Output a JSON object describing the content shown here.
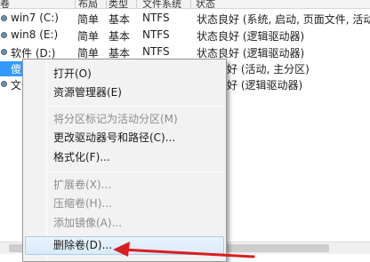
{
  "table": {
    "headers": [
      "卷",
      "布局",
      "类型",
      "文件系统",
      "状态"
    ],
    "rows": [
      {
        "volume": "win7 (C:)",
        "layout": "简单",
        "type": "基本",
        "fs": "NTFS",
        "status": "状态良好 (系统, 启动, 页面文件, 活动,"
      },
      {
        "volume": "win8 (E:)",
        "layout": "简单",
        "type": "基本",
        "fs": "NTFS",
        "status": "状态良好 (逻辑驱动器)"
      },
      {
        "volume": "软件 (D:)",
        "layout": "简单",
        "type": "基本",
        "fs": "NTFS",
        "status": "状态良好 (逻辑驱动器)"
      },
      {
        "volume": "傻瓜",
        "layout": "",
        "type": "",
        "fs": "",
        "status": "好 (活动, 主分区)",
        "selected": true
      },
      {
        "volume": "文件",
        "layout": "",
        "type": "",
        "fs": "",
        "status": "好 (逻辑驱动器)"
      }
    ]
  },
  "context_menu": {
    "items": [
      {
        "label": "打开(O)",
        "enabled": true
      },
      {
        "label": "资源管理器(E)",
        "enabled": true
      },
      {
        "separator": true
      },
      {
        "label": "将分区标记为活动分区(M)",
        "enabled": false
      },
      {
        "label": "更改驱动器号和路径(C)...",
        "enabled": true
      },
      {
        "label": "格式化(F)...",
        "enabled": true
      },
      {
        "separator": true
      },
      {
        "label": "扩展卷(X)...",
        "enabled": false
      },
      {
        "label": "压缩卷(H)...",
        "enabled": false
      },
      {
        "label": "添加镜像(A)...",
        "enabled": false
      },
      {
        "label": "删除卷(D)...",
        "enabled": true,
        "highlighted": true
      }
    ]
  },
  "annotation": {
    "arrow_color": "#d81e1e",
    "arrow_target": "删除卷(D)..."
  }
}
